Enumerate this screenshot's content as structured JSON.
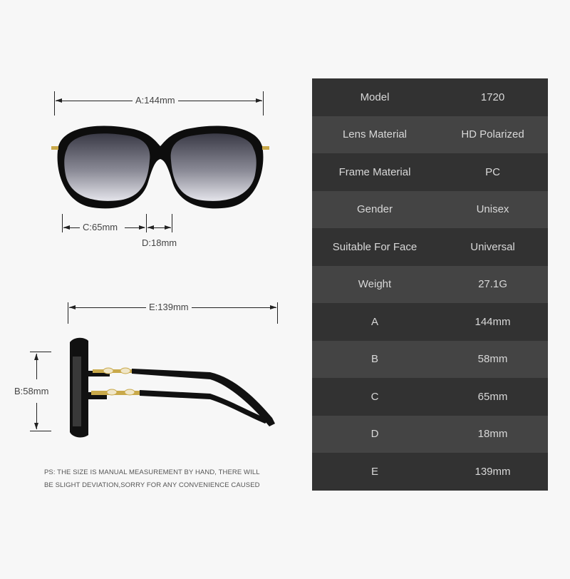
{
  "dimensions": {
    "a_label": "A:144mm",
    "b_label": "B:58mm",
    "c_label": "C:65mm",
    "d_label": "D:18mm",
    "e_label": "E:139mm"
  },
  "product_images": {
    "front_view": "sunglasses-front",
    "side_view": "sunglasses-side"
  },
  "specs": [
    {
      "key": "Model",
      "value": "1720"
    },
    {
      "key": "Lens Material",
      "value": "HD Polarized"
    },
    {
      "key": "Frame Material",
      "value": "PC"
    },
    {
      "key": "Gender",
      "value": "Unisex"
    },
    {
      "key": "Suitable For Face",
      "value": "Universal"
    },
    {
      "key": "Weight",
      "value": "27.1G"
    },
    {
      "key": "A",
      "value": "144mm"
    },
    {
      "key": "B",
      "value": "58mm"
    },
    {
      "key": "C",
      "value": "65mm"
    },
    {
      "key": "D",
      "value": "18mm"
    },
    {
      "key": "E",
      "value": "139mm"
    }
  ],
  "note": {
    "line1": "PS: THE SIZE IS MANUAL MEASUREMENT BY HAND, THERE WILL",
    "line2": "BE SLIGHT DEVIATION,SORRY FOR ANY CONVENIENCE CAUSED"
  },
  "colors": {
    "row_dark": "#323232",
    "row_light": "#444444",
    "text_light": "#d8d8d8",
    "background": "#f7f7f7"
  }
}
